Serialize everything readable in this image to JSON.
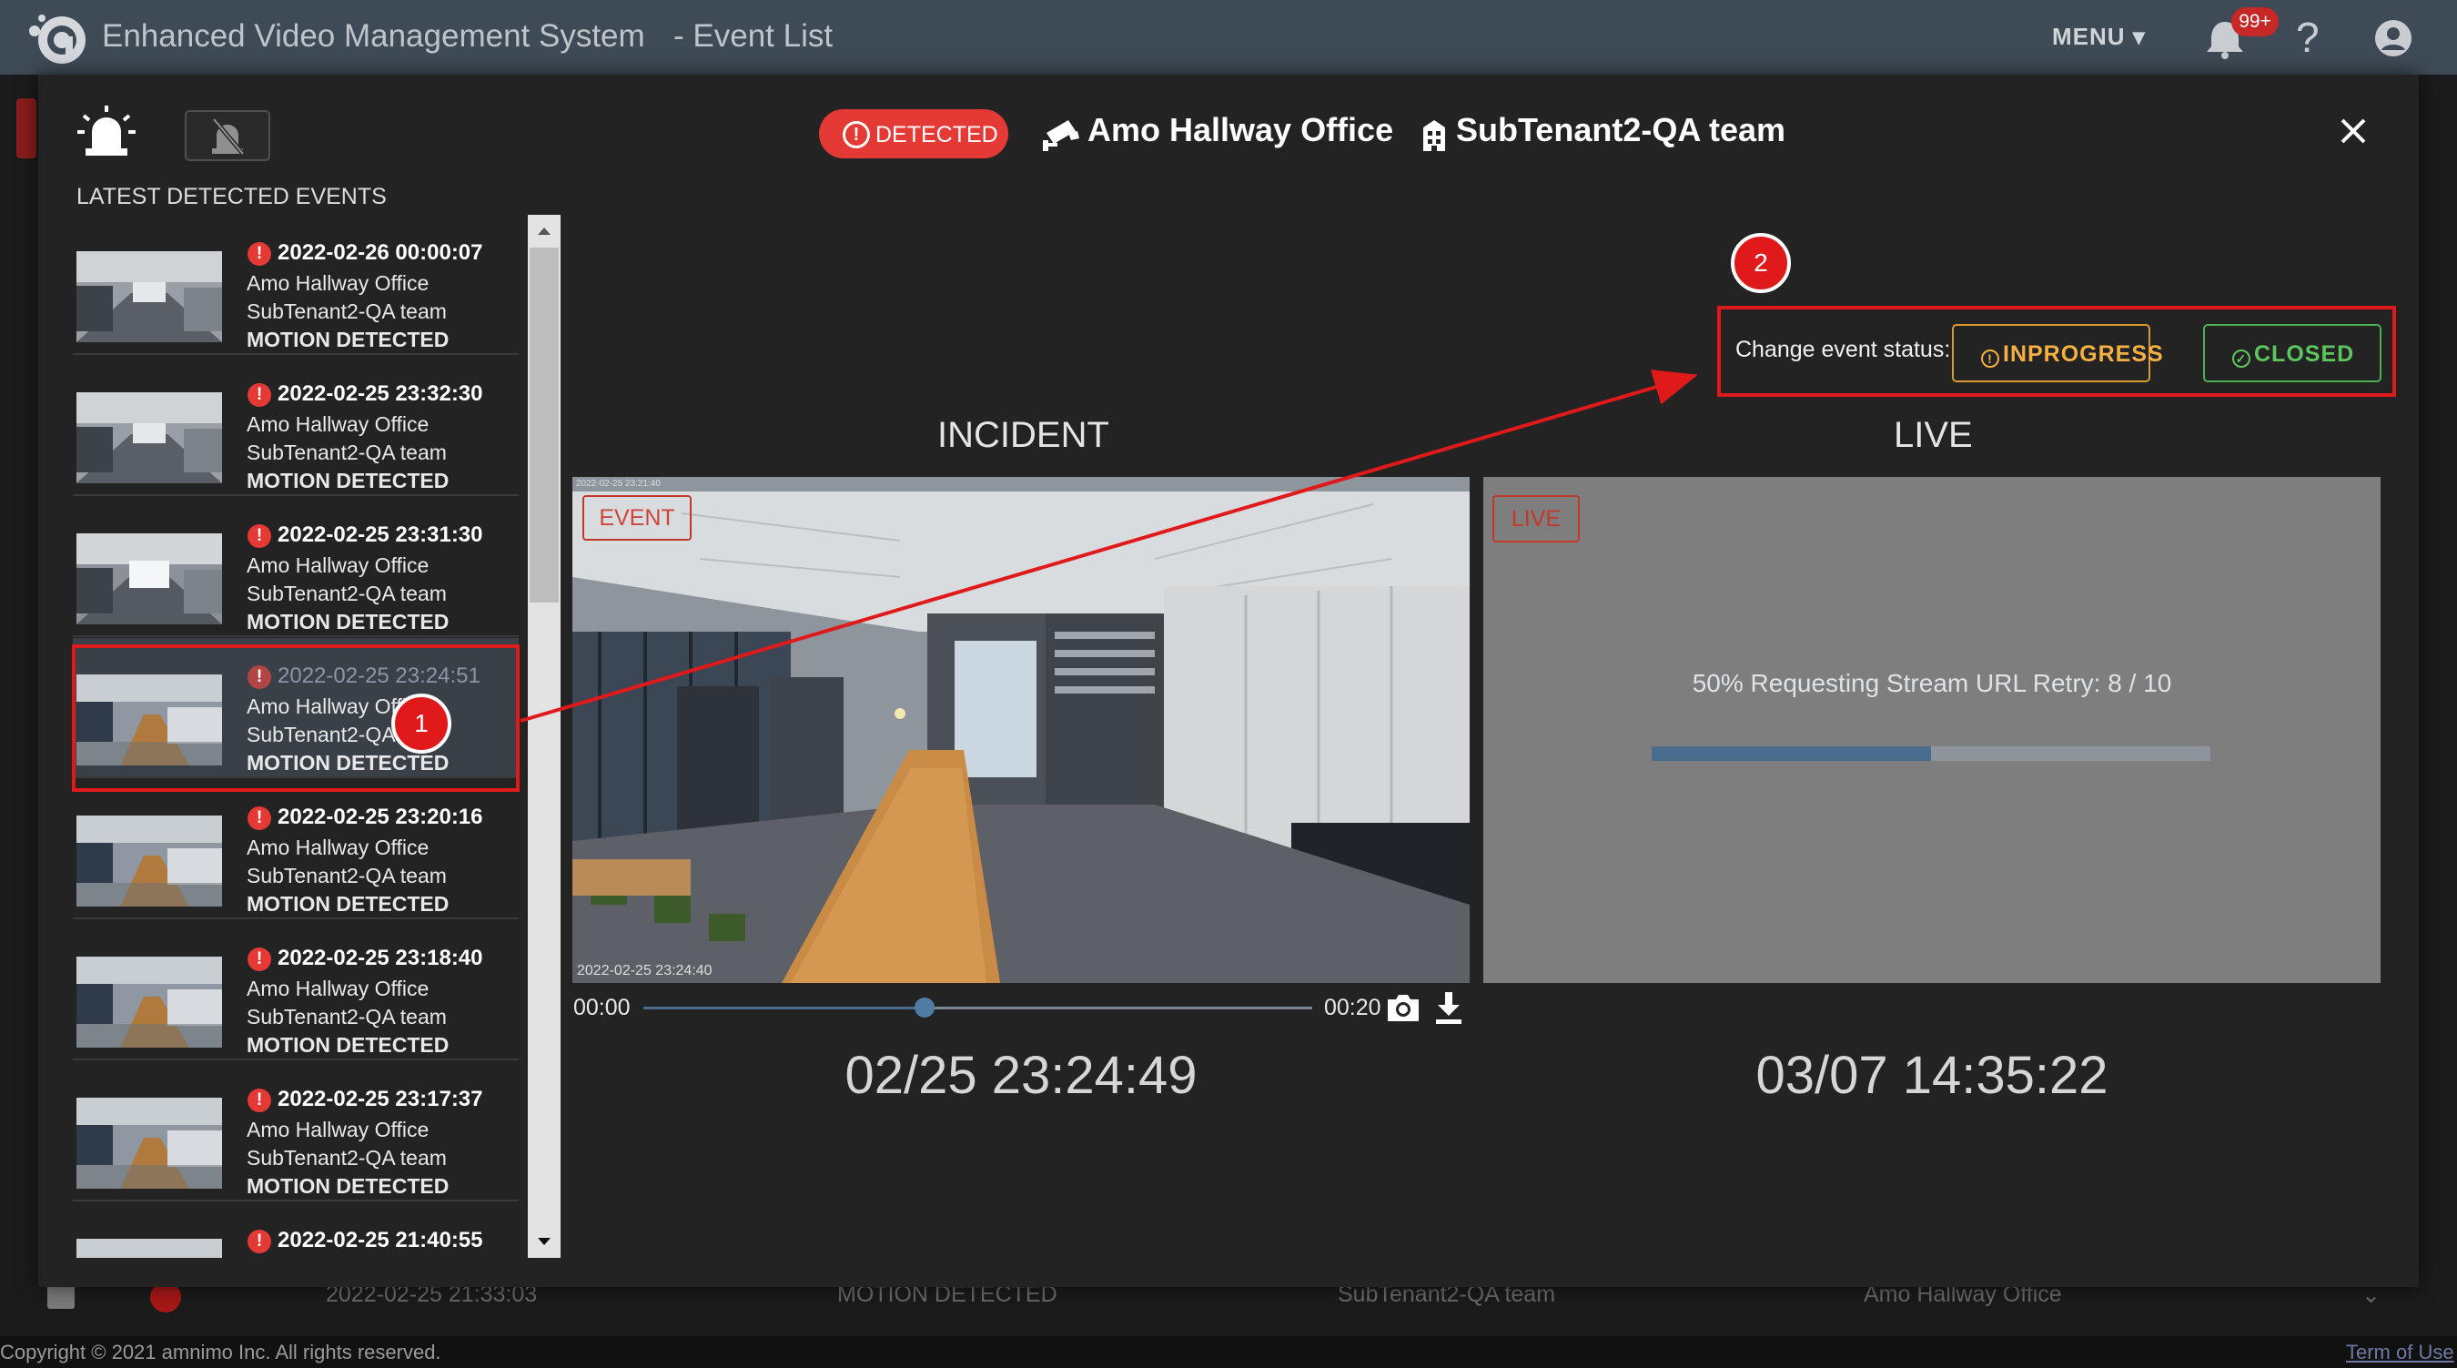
{
  "header": {
    "app_title": "Enhanced Video Management System",
    "page_subtitle": "- Event List",
    "menu_label": "MENU",
    "notification_badge": "99+"
  },
  "modal": {
    "latest_title": "LATEST DETECTED EVENTS",
    "detected_label": "DETECTED",
    "camera_name": "Amo Hallway Office",
    "tenant_name": "SubTenant2-QA team",
    "status_label": "Change event status:",
    "inprogress_label": "INPROGRESS",
    "closed_label": "CLOSED",
    "incident_title": "INCIDENT",
    "live_title": "LIVE",
    "event_tag": "EVENT",
    "live_tag": "LIVE",
    "video_timestamp_top": "2022-02-25 23:21:40",
    "video_timestamp_bottom": "2022-02-25 23:24:40",
    "live_status": "50% Requesting Stream URL Retry: 8 / 10",
    "live_progress": 0.5,
    "playback_start": "00:00",
    "playback_end": "00:20",
    "playback_position": 0.42,
    "incident_time": "02/25 23:24:49",
    "live_time": "03/07 14:35:22"
  },
  "events": [
    {
      "time": "2022-02-26 00:00:07",
      "camera": "Amo Hallway Office",
      "tenant": "SubTenant2-QA team",
      "type": "MOTION DETECTED"
    },
    {
      "time": "2022-02-25 23:32:30",
      "camera": "Amo Hallway Office",
      "tenant": "SubTenant2-QA team",
      "type": "MOTION DETECTED"
    },
    {
      "time": "2022-02-25 23:31:30",
      "camera": "Amo Hallway Office",
      "tenant": "SubTenant2-QA team",
      "type": "MOTION DETECTED"
    },
    {
      "time": "2022-02-25 23:24:51",
      "camera": "Amo Hallway Office",
      "tenant": "SubTenant2-QA team",
      "type": "MOTION DETECTED"
    },
    {
      "time": "2022-02-25 23:20:16",
      "camera": "Amo Hallway Office",
      "tenant": "SubTenant2-QA team",
      "type": "MOTION DETECTED"
    },
    {
      "time": "2022-02-25 23:18:40",
      "camera": "Amo Hallway Office",
      "tenant": "SubTenant2-QA team",
      "type": "MOTION DETECTED"
    },
    {
      "time": "2022-02-25 23:17:37",
      "camera": "Amo Hallway Office",
      "tenant": "SubTenant2-QA team",
      "type": "MOTION DETECTED"
    },
    {
      "time": "2022-02-25 21:40:55",
      "camera": "",
      "tenant": "",
      "type": ""
    }
  ],
  "annotations": {
    "callout_1": "1",
    "callout_2": "2"
  },
  "background_row": {
    "time": "2022-02-25 21:33:03",
    "type": "MOTION DETECTED",
    "tenant": "SubTenant2-QA team",
    "camera": "Amo Hallway Office"
  },
  "footer": {
    "copyright": "Copyright © 2021 amnimo Inc. All rights reserved.",
    "terms": "Term of Use"
  },
  "colors": {
    "topbar": "#3e4a55",
    "modal_bg": "#232323",
    "alert_red": "#e53935",
    "annotation_red": "#e01a1a",
    "inprogress": "#f4b042",
    "closed": "#5ec65e",
    "progress_fill": "#4a6c8e"
  },
  "icons": [
    "logo-icon",
    "bell-icon",
    "help-icon",
    "account-icon",
    "siren-icon",
    "siren-off-icon",
    "alert-icon",
    "camera-icon",
    "building-icon",
    "close-icon",
    "snapshot-icon",
    "download-icon",
    "chevron-up-icon",
    "chevron-down-icon"
  ]
}
